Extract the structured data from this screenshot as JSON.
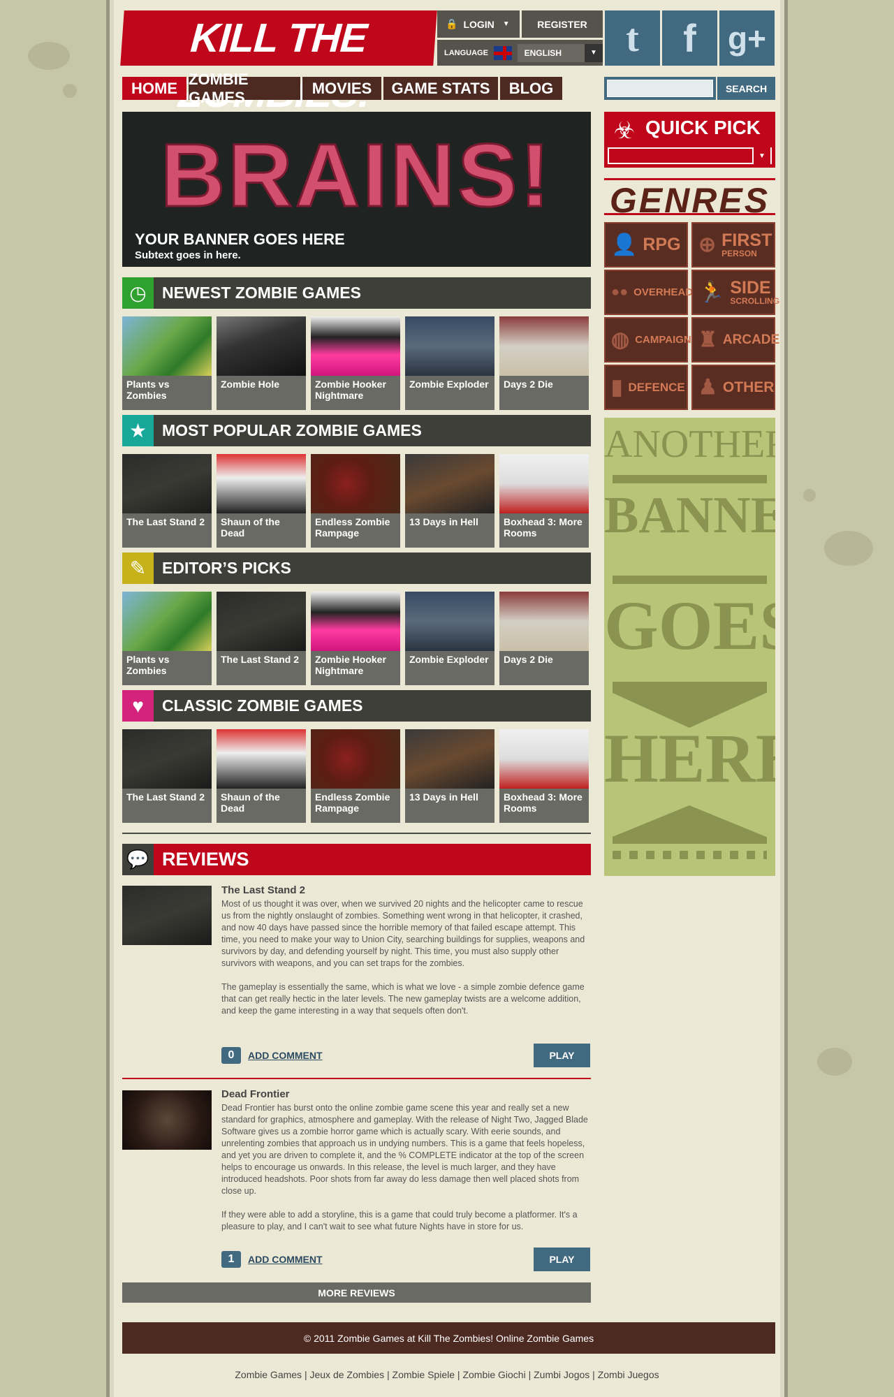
{
  "header": {
    "logo": "KILL THE ZOMBIES!",
    "login": "LOGIN",
    "register": "REGISTER",
    "language_label": "LANGUAGE",
    "language_value": "ENGLISH",
    "social": [
      {
        "icon": "twitter-icon",
        "glyph": "t"
      },
      {
        "icon": "facebook-icon",
        "glyph": "f"
      },
      {
        "icon": "google-plus-icon",
        "glyph": "g+"
      }
    ]
  },
  "nav": {
    "items": [
      "HOME",
      "ZOMBIE GAMES",
      "MOVIES",
      "GAME STATS",
      "BLOG"
    ],
    "active": "HOME",
    "search_button": "SEARCH"
  },
  "banner": {
    "art_text": "BRAINS!",
    "title": "YOUR BANNER GOES HERE",
    "subtitle": "Subtext goes in here."
  },
  "sections": [
    {
      "title": "NEWEST ZOMBIE GAMES",
      "icon": "clock-icon",
      "color": "#2fa12f",
      "games": [
        "Plants vs Zombies",
        "Zombie Hole",
        "Zombie Hooker Nightmare",
        "Zombie Exploder",
        "Days 2 Die"
      ]
    },
    {
      "title": "MOST POPULAR ZOMBIE GAMES",
      "icon": "star-icon",
      "color": "#17a89a",
      "games": [
        "The Last Stand 2",
        "Shaun of the Dead",
        "Endless Zombie Rampage",
        "13 Days in Hell",
        "Boxhead 3: More Rooms"
      ]
    },
    {
      "title": "EDITOR’S PICKS",
      "icon": "pencil-icon",
      "color": "#c6b21a",
      "games": [
        "Plants vs Zombies",
        "The Last Stand 2",
        "Zombie Hooker Nightmare",
        "Zombie Exploder",
        "Days 2 Die"
      ]
    },
    {
      "title": "CLASSIC ZOMBIE GAMES",
      "icon": "heart-icon",
      "color": "#d4237a",
      "games": [
        "The Last Stand 2",
        "Shaun of the Dead",
        "Endless Zombie Rampage",
        "13 Days in Hell",
        "Boxhead 3: More Rooms"
      ]
    }
  ],
  "reviews": {
    "title": "REVIEWS",
    "items": [
      {
        "title": "The Last Stand 2",
        "paragraphs": [
          "Most of us thought it was over, when we survived 20 nights and the helicopter came to rescue us from the nightly onslaught of zombies.  Something went wrong in that helicopter, it crashed, and now 40 days have passed since the horrible memory of that failed escape attempt.  This time, you need to make your way to Union City, searching buildings for supplies, weapons and survivors by day, and defending yourself by night.  This time, you must also supply other survivors with weapons, and you can set traps for the zombies.",
          "The gameplay is essentially the same, which is what we love - a simple zombie defence game that can get really hectic in the later levels.  The new gameplay twists are a welcome addition, and keep the game interesting in a way that sequels often don't."
        ],
        "comments": "0",
        "add_comment": "ADD COMMENT",
        "play": "PLAY"
      },
      {
        "title": "Dead Frontier",
        "paragraphs": [
          "Dead Frontier has burst onto the online zombie game scene this year and really set a new standard for graphics, atmosphere and gameplay. With the release of Night Two, Jagged Blade Software gives us a zombie horror game which is actually scary. With eerie sounds, and unrelenting zombies that approach us in undying numbers. This is a game that feels hopeless, and yet you are driven to complete it, and the % COMPLETE indicator at the top of the screen helps to encourage us onwards. In this release, the level is much larger, and they have introduced headshots. Poor shots from far away do less damage then well placed shots from close up.",
          "If they were able to add a storyline, this is a game that could truly become a platformer. It's a pleasure to play, and I can't wait to see what future Nights have in store for us."
        ],
        "comments": "1",
        "add_comment": "ADD COMMENT",
        "play": "PLAY"
      }
    ],
    "more": "MORE REVIEWS"
  },
  "sidebar": {
    "quick_pick": "QUICK PICK",
    "genres_title": "GENRES",
    "genres": [
      {
        "label": "RPG",
        "sub": "",
        "icon": "person-icon"
      },
      {
        "label": "FIRST",
        "sub": "PERSON",
        "icon": "crosshair-icon"
      },
      {
        "label": "OVERHEAD",
        "sub": "",
        "icon": "footprints-icon"
      },
      {
        "label": "SIDE",
        "sub": "SCROLLING",
        "icon": "runner-icon"
      },
      {
        "label": "CAMPAIGN",
        "sub": "",
        "icon": "globe-icon"
      },
      {
        "label": "ARCADE",
        "sub": "",
        "icon": "joystick-icon"
      },
      {
        "label": "DEFENCE",
        "sub": "",
        "icon": "tower-icon"
      },
      {
        "label": "OTHER",
        "sub": "",
        "icon": "pawn-icon"
      }
    ],
    "ad": [
      "ANOTHER",
      "BANNER",
      "GOES",
      "HERE"
    ]
  },
  "footer": {
    "copyright": "© 2011 Zombie Games at Kill The Zombies! Online Zombie Games",
    "links": [
      "Zombie Games",
      "Jeux de Zombies",
      "Zombie Spiele",
      "Zombie Giochi",
      "Zumbi Jogos",
      "Zombi Juegos"
    ]
  },
  "colors": {
    "brand_red": "#c0061a",
    "nav_brown": "#4c2a22",
    "accent_blue": "#41697f"
  }
}
